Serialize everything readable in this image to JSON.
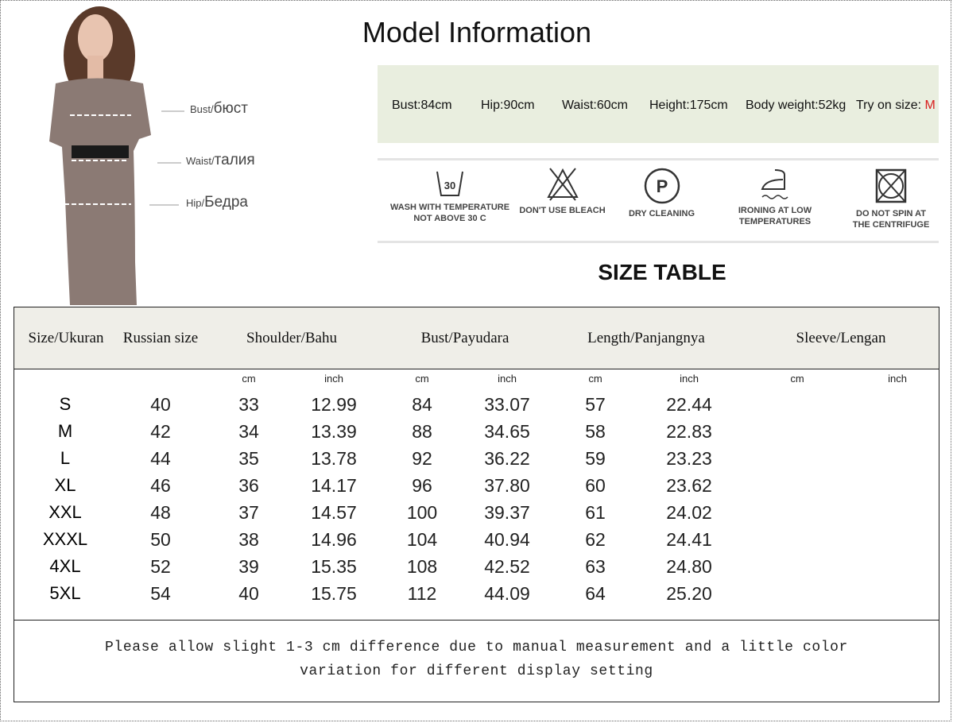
{
  "title": "Model Information",
  "model_figure": {
    "labels": [
      {
        "small": "Bust/",
        "big": "бюст"
      },
      {
        "small": "Waist/",
        "big": "талия"
      },
      {
        "small": "Hip/",
        "big": "Бедра"
      }
    ],
    "dress_color": "#8b7a74"
  },
  "model_info": {
    "bust": "Bust:84cm",
    "hip": "Hip:90cm",
    "waist": "Waist:60cm",
    "height": "Height:175cm",
    "weight": "Body weight:52kg",
    "try_on_label": "Try on size: ",
    "try_on_value": "M",
    "bg_color": "#e9eedf",
    "accent_color": "#d81e1e"
  },
  "care": [
    {
      "icon": "wash-30-icon",
      "line1": "WASH WITH TEMPERATURE",
      "line2": "NOT ABOVE 30 C",
      "num": "30"
    },
    {
      "icon": "no-bleach-icon",
      "line1": "DON'T USE BLEACH",
      "line2": ""
    },
    {
      "icon": "dry-clean-p-icon",
      "line1": "DRY CLEANING",
      "line2": "",
      "num": "P"
    },
    {
      "icon": "iron-low-icon",
      "line1": "IRONING AT LOW",
      "line2": "TEMPERATURES"
    },
    {
      "icon": "no-tumble-dry-icon",
      "line1": "DO NOT SPIN AT",
      "line2": "THE CENTRIFUGE"
    }
  ],
  "size_table_title": "SIZE TABLE",
  "table": {
    "headers": [
      "Size/Ukuran",
      "Russian size",
      "Shoulder/Bahu",
      "Bust/Payudara",
      "Length/Panjangnya",
      "Sleeve/Lengan"
    ],
    "units": [
      "cm",
      "inch",
      "cm",
      "inch",
      "cm",
      "inch",
      "cm",
      "inch"
    ],
    "rows": [
      [
        "S",
        "40",
        "33",
        "12.99",
        "84",
        "33.07",
        "57",
        "22.44"
      ],
      [
        "M",
        "42",
        "34",
        "13.39",
        "88",
        "34.65",
        "58",
        "22.83"
      ],
      [
        "L",
        "44",
        "35",
        "13.78",
        "92",
        "36.22",
        "59",
        "23.23"
      ],
      [
        "XL",
        "46",
        "36",
        "14.17",
        "96",
        "37.80",
        "60",
        "23.62"
      ],
      [
        "XXL",
        "48",
        "37",
        "14.57",
        "100",
        "39.37",
        "61",
        "24.02"
      ],
      [
        "XXXL",
        "50",
        "38",
        "14.96",
        "104",
        "40.94",
        "62",
        "24.41"
      ],
      [
        "4XL",
        "52",
        "39",
        "15.35",
        "108",
        "42.52",
        "63",
        "24.80"
      ],
      [
        "5XL",
        "54",
        "40",
        "15.75",
        "112",
        "44.09",
        "64",
        "25.20"
      ]
    ],
    "header_bg": "#efeee8"
  },
  "note": {
    "line1": "Please allow slight 1-3 cm difference due to manual measurement and a little color",
    "line2": "variation for different display setting"
  }
}
